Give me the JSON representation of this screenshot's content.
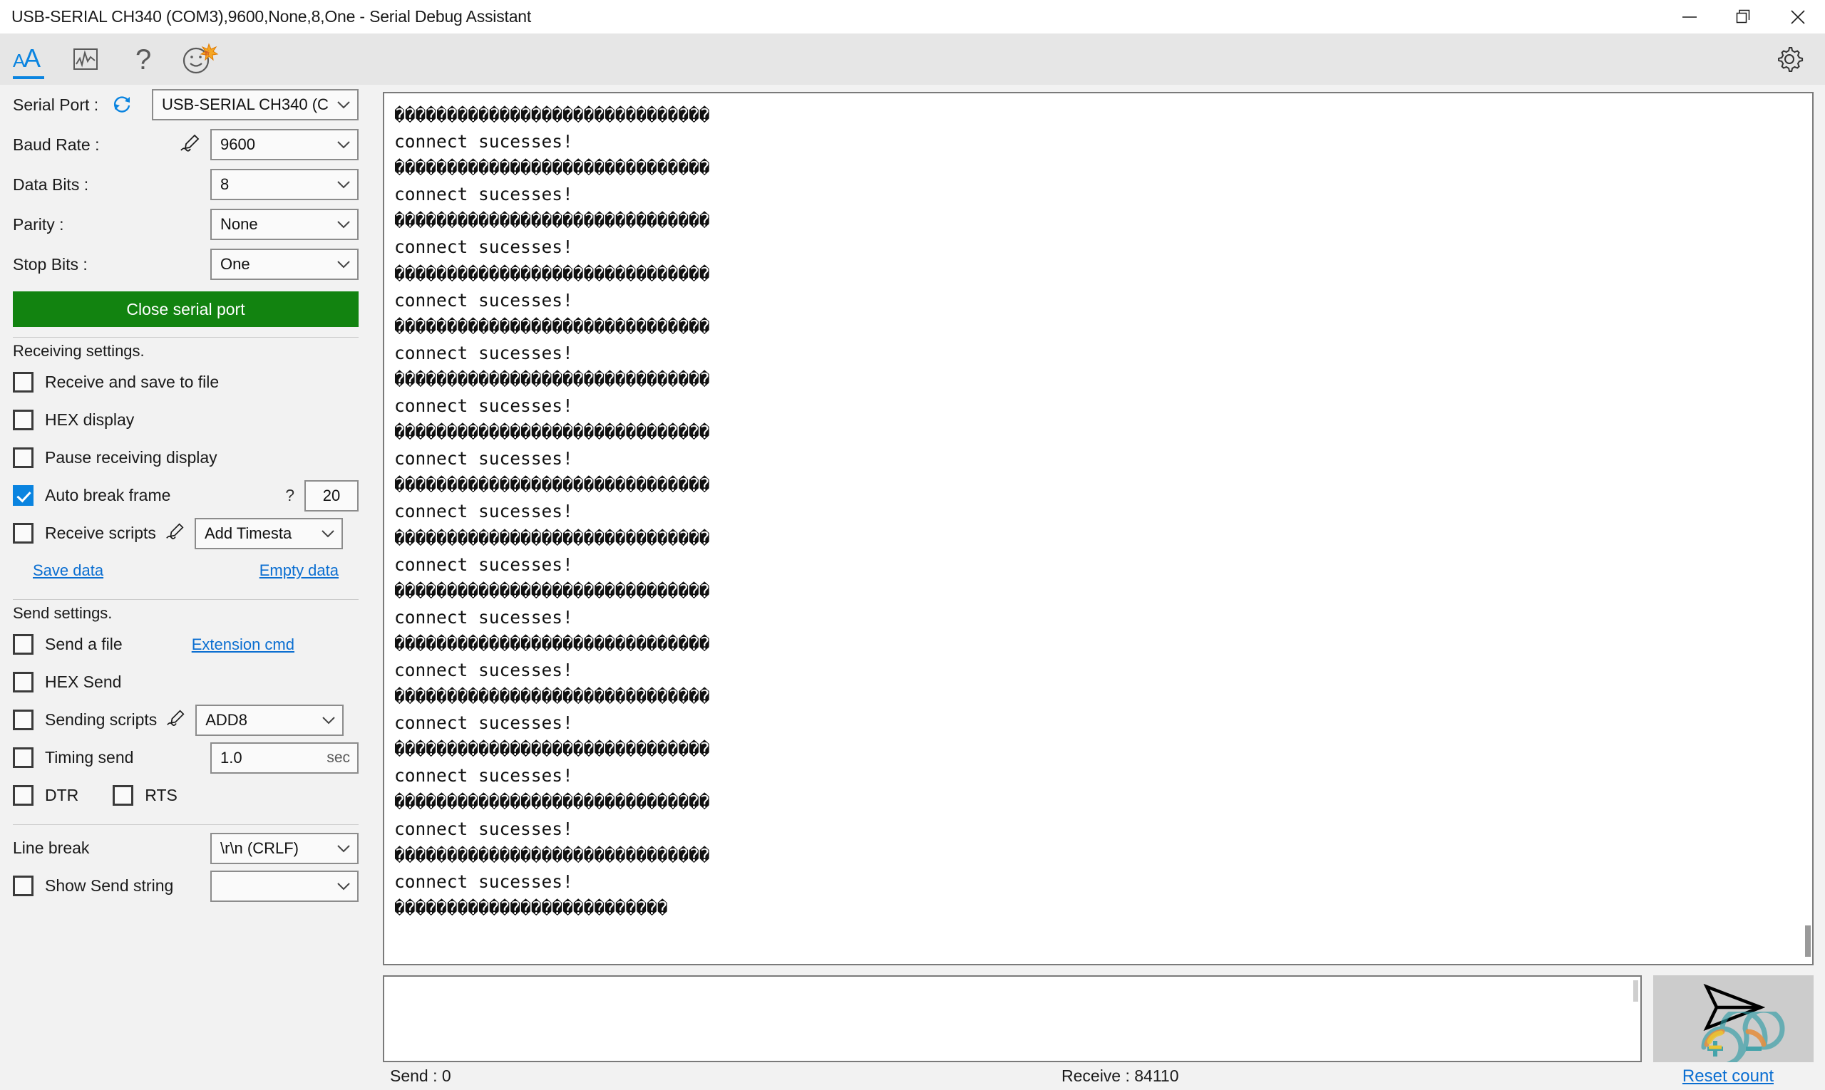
{
  "window": {
    "title": "USB-SERIAL CH340 (COM3),9600,None,8,One - Serial Debug Assistant",
    "minimize_label": "minimize",
    "restore_label": "restore",
    "close_label": "close"
  },
  "toolbar": {
    "items": [
      {
        "name": "font-size-icon",
        "label": "AA"
      },
      {
        "name": "waveform-icon",
        "label": "waveform"
      },
      {
        "name": "help-icon",
        "label": "?"
      },
      {
        "name": "smiley-icon",
        "label": "smiley"
      }
    ],
    "settings_label": "gear-icon"
  },
  "sidebar": {
    "serial_port": {
      "label": "Serial Port :",
      "value": "USB-SERIAL CH340 (C",
      "refresh_icon": "refresh-icon"
    },
    "baud_rate": {
      "label": "Baud Rate :",
      "value": "9600",
      "pen_icon": "pen-icon"
    },
    "data_bits": {
      "label": "Data Bits :",
      "value": "8"
    },
    "parity": {
      "label": "Parity :",
      "value": "None"
    },
    "stop_bits": {
      "label": "Stop Bits :",
      "value": "One"
    },
    "close_port_button": "Close serial port",
    "receiving": {
      "title": "Receiving settings.",
      "receive_and_save": {
        "label": "Receive and save to file",
        "checked": false
      },
      "hex_display": {
        "label": "HEX display",
        "checked": false
      },
      "pause_receiving": {
        "label": "Pause receiving display",
        "checked": false
      },
      "auto_break_frame": {
        "label": "Auto break frame",
        "checked": true,
        "help": "?",
        "value": "20"
      },
      "receive_scripts": {
        "label": "Receive scripts",
        "checked": false,
        "value": "Add Timesta"
      },
      "save_data_link": "Save data",
      "empty_data_link": "Empty data"
    },
    "send": {
      "title": "Send settings.",
      "send_a_file": {
        "label": "Send a file",
        "checked": false
      },
      "extension_cmd_link": "Extension cmd",
      "hex_send": {
        "label": "HEX Send",
        "checked": false
      },
      "sending_scripts": {
        "label": "Sending scripts",
        "checked": false,
        "value": "ADD8"
      },
      "timing_send": {
        "label": "Timing send",
        "checked": false,
        "value": "1.0",
        "unit": "sec"
      },
      "dtr": {
        "label": "DTR",
        "checked": false
      },
      "rts": {
        "label": "RTS",
        "checked": false
      }
    },
    "line_break": {
      "label": "Line break",
      "value": "\\r\\n (CRLF)"
    },
    "show_send_string": {
      "label": "Show Send string",
      "color": "#000000"
    }
  },
  "terminal": {
    "garbled_line": "������������������������������",
    "message_line": "connect sucesses!",
    "last_partial_line": "��������������������������",
    "repeat_count": 15
  },
  "send_panel": {
    "input_value": "",
    "input_placeholder": "",
    "send_icon": "paper-plane-icon",
    "watermark": "arduino-logo"
  },
  "status_bar": {
    "send_label": "Send : 0",
    "receive_label": "Receive : 84110",
    "reset_count_link": "Reset count"
  },
  "colors": {
    "accent": "#0a84e0",
    "close_port_green": "#128310",
    "link": "#0a6ed1",
    "toolbar_bg": "#e6e6e6",
    "sidebar_bg": "#f2f2f2"
  }
}
